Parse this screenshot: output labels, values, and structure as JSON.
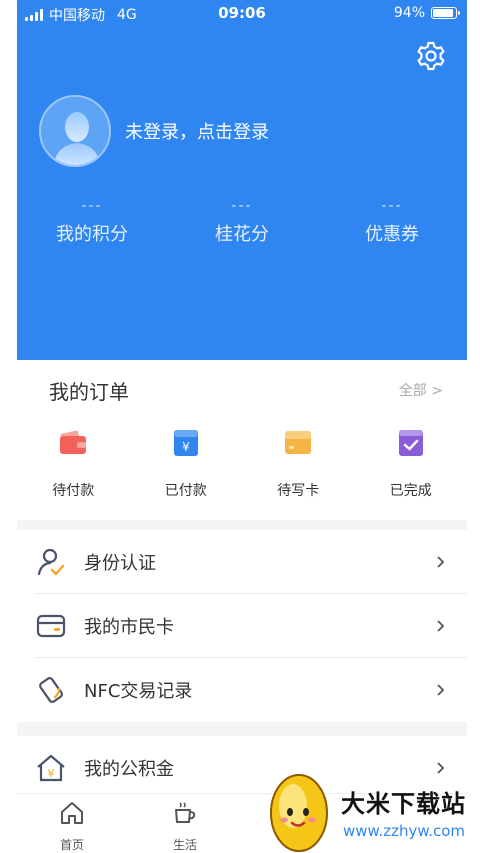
{
  "status_bar": {
    "carrier": "中国移动",
    "network": "4G",
    "time": "09:06",
    "battery": "94%"
  },
  "header": {
    "login_prompt": "未登录，点击登录",
    "settings_icon": "gear-icon",
    "stats": [
      {
        "value": "---",
        "label": "我的积分"
      },
      {
        "value": "---",
        "label": "桂花分"
      },
      {
        "value": "---",
        "label": "优惠券"
      }
    ]
  },
  "orders": {
    "title": "我的订单",
    "all_link": "全部 >",
    "items": [
      {
        "label": "待付款",
        "icon": "wallet-icon",
        "color": "#f0625a"
      },
      {
        "label": "已付款",
        "icon": "yen-box-icon",
        "color": "#2f86f0"
      },
      {
        "label": "待写卡",
        "icon": "card-icon",
        "color": "#f5b544"
      },
      {
        "label": "已完成",
        "icon": "check-box-icon",
        "color": "#8a5cd6"
      }
    ]
  },
  "menu_group_1": [
    {
      "label": "身份认证",
      "icon": "user-check-icon"
    },
    {
      "label": "我的市民卡",
      "icon": "citizen-card-icon"
    },
    {
      "label": "NFC交易记录",
      "icon": "nfc-icon"
    }
  ],
  "menu_group_2": [
    {
      "label": "我的公积金",
      "icon": "housing-fund-icon"
    }
  ],
  "tabbar": {
    "tabs": [
      {
        "label": "首页",
        "icon": "home-icon"
      },
      {
        "label": "生活",
        "icon": "coffee-icon"
      }
    ]
  },
  "watermark": {
    "text": "大米下载站",
    "url": "www.zzhyw.com"
  },
  "colors": {
    "primary": "#2f86f0",
    "accent_orange": "#f5b544"
  }
}
